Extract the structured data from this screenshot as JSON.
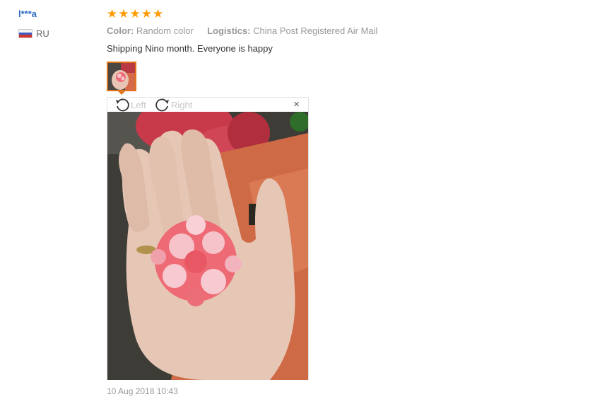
{
  "review": {
    "user_name": "l***a",
    "country_code": "RU",
    "rating": 5,
    "stars": [
      "★",
      "★",
      "★",
      "★",
      "★"
    ],
    "color_label": "Color:",
    "color_value": "Random color",
    "logistics_label": "Logistics:",
    "logistics_value": "China Post Registered Air Mail",
    "text": "Shipping Nino month. Everyone is happy",
    "timestamp": "10 Aug 2018 10:43"
  },
  "viewer": {
    "rotate_left_label": "Left",
    "rotate_right_label": "Right",
    "close_glyph": "×"
  },
  "colors": {
    "username": "#2f6cc4",
    "star": "#ff9a00",
    "thumb_border": "#e0741a",
    "muted_text": "#999999"
  }
}
